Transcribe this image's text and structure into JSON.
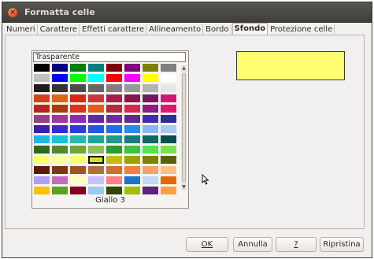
{
  "window": {
    "title": "Formatta celle",
    "close_glyph": "×"
  },
  "tabs": [
    {
      "label": "Numeri",
      "active": false
    },
    {
      "label": "Carattere",
      "active": false
    },
    {
      "label": "Effetti carattere",
      "active": false
    },
    {
      "label": "Allineamento",
      "active": false
    },
    {
      "label": "Bordo",
      "active": false
    },
    {
      "label": "Sfondo",
      "active": true
    },
    {
      "label": "Protezione celle",
      "active": false
    }
  ],
  "palette": {
    "transparent_label": "Trasparente",
    "selected_color_name": "Giallo 3",
    "selected_index": 75,
    "colors": [
      "#000000",
      "#000080",
      "#008000",
      "#008080",
      "#800000",
      "#800080",
      "#808000",
      "#808080",
      "#c0c0c0",
      "#0000ff",
      "#00ff00",
      "#00ffff",
      "#ff0000",
      "#ff00ff",
      "#ffff00",
      "#ffffff",
      "#1c1c1c",
      "#333333",
      "#4c4c4c",
      "#666666",
      "#808080",
      "#999999",
      "#b3b3b3",
      "#e6e6e6",
      "#d53f1c",
      "#d06a1b",
      "#d6271f",
      "#c7393d",
      "#a02248",
      "#86174d",
      "#711a5a",
      "#d4176e",
      "#b3281c",
      "#a43c10",
      "#d6341c",
      "#e05c1e",
      "#b02d3c",
      "#d8274f",
      "#8b2080",
      "#e0186b",
      "#96408c",
      "#9c38a0",
      "#8a2bb7",
      "#5a2aa8",
      "#6e2ca0",
      "#5c2d91",
      "#3f2db0",
      "#2b2e94",
      "#3c1fa8",
      "#3a2ad0",
      "#2a3ce0",
      "#1f57e6",
      "#1e6ee8",
      "#2a8ae8",
      "#88b8f0",
      "#a8c8f0",
      "#1ab9e5",
      "#14c5d8",
      "#1dbfb0",
      "#19a796",
      "#21998a",
      "#1b7b7b",
      "#116767",
      "#0a4f4f",
      "#2f6a1e",
      "#4e8a2b",
      "#6ea53d",
      "#8cc059",
      "#2c9c2c",
      "#3cc43c",
      "#4ce84c",
      "#7ae04a",
      "#ffff70",
      "#ffffa0",
      "#ffff70",
      "#e0e000",
      "#c0c000",
      "#a0a000",
      "#808000",
      "#606000",
      "#5c1a00",
      "#7a3810",
      "#9a5426",
      "#b0703a",
      "#d46c2a",
      "#f08040",
      "#f5a268",
      "#f7c090",
      "#b0a0f0",
      "#c06cc0",
      "#ffffc0",
      "#c8c0ff",
      "#ff8080",
      "#1c74c4",
      "#c0d8f0",
      "#e06c00",
      "#ffc000",
      "#5fa020",
      "#800020",
      "#a0c8f0",
      "#304800",
      "#a0c000",
      "#602080",
      "#ffa040"
    ]
  },
  "preview": {
    "color": "#ffff70"
  },
  "buttons": {
    "ok": "OK",
    "cancel": "Annulla",
    "help": "?",
    "reset": "Ripristina"
  }
}
